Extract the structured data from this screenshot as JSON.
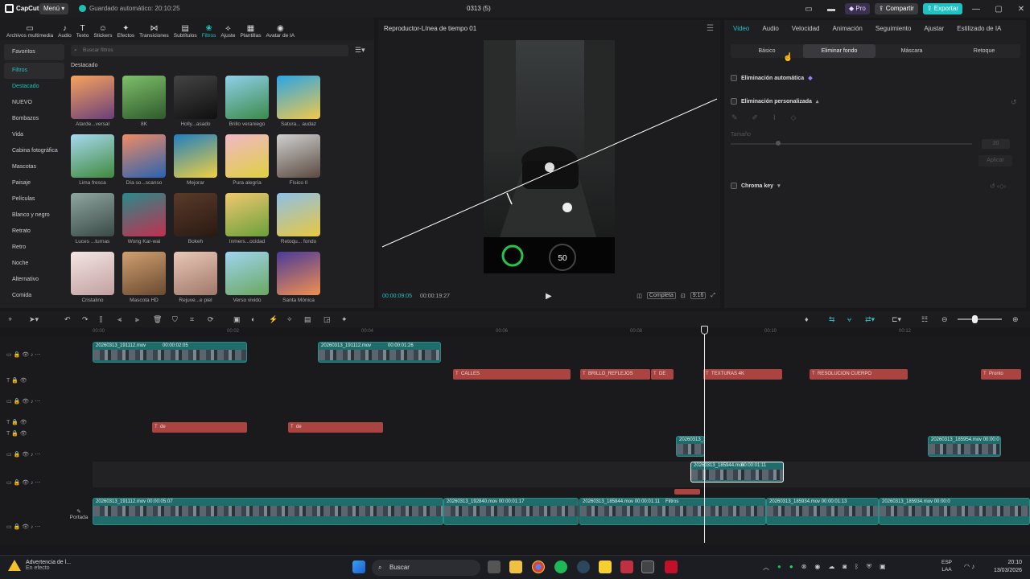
{
  "titlebar": {
    "app_name": "CapCut",
    "menu_label": "Menú",
    "autosave_text": "Guardado automático: 20:10:25",
    "project_title": "0313 (5)",
    "pro_label": "Pro",
    "share_label": "Compartir",
    "export_label": "Exportar"
  },
  "media_toolbar": [
    {
      "label": "Archivos multimedia",
      "icon": "▭"
    },
    {
      "label": "Audio",
      "icon": "♪"
    },
    {
      "label": "Texto",
      "icon": "T"
    },
    {
      "label": "Stickers",
      "icon": "☺"
    },
    {
      "label": "Efectos",
      "icon": "✦"
    },
    {
      "label": "Transiciones",
      "icon": "⋈"
    },
    {
      "label": "Subtítulos",
      "icon": "▤"
    },
    {
      "label": "Filtros",
      "icon": "❀"
    },
    {
      "label": "Ajuste",
      "icon": "⟡"
    },
    {
      "label": "Plantillas",
      "icon": "▦"
    },
    {
      "label": "Avatar de IA",
      "icon": "◉"
    }
  ],
  "filters_panel": {
    "search_placeholder": "Buscar filtros",
    "section_title": "Destacado",
    "categories": [
      "Favoritos",
      "Filtros",
      "Destacado",
      "NUEVO",
      "Bombazos",
      "Vida",
      "Cabina fotográfica",
      "Mascotas",
      "Paisaje",
      "Películas",
      "Blanco y negro",
      "Retrato",
      "Retro",
      "Noche",
      "Alternativo",
      "Comida"
    ],
    "tiles": [
      {
        "label": "Atarde...versal",
        "colors": [
          "#f7a35c",
          "#6a3f7a"
        ]
      },
      {
        "label": "8K",
        "colors": [
          "#7fbf6a",
          "#2f5a2c"
        ]
      },
      {
        "label": "Holly...asado",
        "colors": [
          "#444444",
          "#0f0f0f"
        ]
      },
      {
        "label": "Brillo veraniego",
        "colors": [
          "#8fd0ea",
          "#3c8a4a"
        ]
      },
      {
        "label": "Satura... audaz",
        "colors": [
          "#2aa5e6",
          "#f2c84a"
        ]
      },
      {
        "label": "Lima fresca",
        "colors": [
          "#a8d8f0",
          "#3f8a3c"
        ]
      },
      {
        "label": "Día so...scanso",
        "colors": [
          "#f08c64",
          "#2a62b0"
        ]
      },
      {
        "label": "Mejorar",
        "colors": [
          "#1f7fc0",
          "#f0d040"
        ]
      },
      {
        "label": "Pura alegría",
        "colors": [
          "#f0b8c8",
          "#e0d040"
        ]
      },
      {
        "label": "Físico II",
        "colors": [
          "#d0d0d0",
          "#5a4a40"
        ]
      },
      {
        "label": "Luces ...turnas",
        "colors": [
          "#8fa6a0",
          "#3a4a46"
        ]
      },
      {
        "label": "Wong Kar-wai",
        "colors": [
          "#2a8a8a",
          "#c03050"
        ]
      },
      {
        "label": "Bokeh",
        "colors": [
          "#5a3a2a",
          "#2a1a12"
        ]
      },
      {
        "label": "Inmers...ocidad",
        "colors": [
          "#f0c870",
          "#6aa03a"
        ]
      },
      {
        "label": "Retoqu... fondo",
        "colors": [
          "#8ec0e8",
          "#e8c840"
        ]
      },
      {
        "label": "Cristalino",
        "colors": [
          "#f4e6e4",
          "#c0a0a0"
        ]
      },
      {
        "label": "Mascota HD",
        "colors": [
          "#d0a070",
          "#6a4a30"
        ]
      },
      {
        "label": "Rejuve...e piel",
        "colors": [
          "#e8c8b8",
          "#a07868"
        ]
      },
      {
        "label": "Verso vivido",
        "colors": [
          "#9fd4f0",
          "#6aa860"
        ]
      },
      {
        "label": "Santa Mónica",
        "colors": [
          "#4a3a9a",
          "#f09050"
        ]
      }
    ]
  },
  "player": {
    "title": "Reproductor-Línea de tiempo 01",
    "current_time": "00:00:09:05",
    "total_time": "00:00:19:27",
    "quality_label": "Completa",
    "ratio_label": "9:16",
    "speed_readout": "50"
  },
  "inspector": {
    "tabs": [
      "Video",
      "Audio",
      "Velocidad",
      "Animación",
      "Seguimiento",
      "Ajustar",
      "Estilizado de IA"
    ],
    "subtabs": [
      "Básico",
      "Eliminar fondo",
      "Máscara",
      "Retoque"
    ],
    "auto_removal": "Eliminación automática",
    "custom_removal": "Eliminación personalizada",
    "size_label": "Tamaño",
    "size_value": "30",
    "apply_label": "Aplicar",
    "chroma_key": "Chroma key"
  },
  "timeline": {
    "ruler": [
      "00:00",
      "00:02",
      "00:04",
      "00:06",
      "00:08",
      "00:10",
      "00:12"
    ],
    "video_clips_top": [
      {
        "name": "20260313_191112.mov",
        "dur": "00:00:02:05"
      },
      {
        "name": "20260313_191112.mov",
        "dur": "00:00:01:26"
      }
    ],
    "text_clips": [
      "CALLES",
      "BRILLO_REFLEJOS",
      "DE",
      "TEXTURAS 4K",
      "RESOLUCION CUERPO",
      "Pronto"
    ],
    "text_clips_2": [
      "de",
      "de"
    ],
    "overlay_clips": [
      "20260313_1",
      "20260313_185954.mov  00:00:0"
    ],
    "selected_clip": {
      "name": "20260313_185944.mov",
      "dur": "00:00:01:11"
    },
    "main_track": [
      {
        "name": "20260313_191112.mov  00:00:05:07"
      },
      {
        "name": "20260313_192840.mov  00:00:01:17"
      },
      {
        "name": "20260313_185844.mov  00:00:01:11"
      },
      {
        "name": "20260313_185934.mov  00:00:01:13"
      },
      {
        "name": "20260313_185934.mov  00:00:0"
      }
    ],
    "filter_tag": "Filtros",
    "cover_label": "Portada"
  },
  "taskbar": {
    "warning_title": "Advertencia de l...",
    "warning_sub": "En efecto",
    "search_label": "Buscar",
    "lang_1": "ESP",
    "lang_2": "LAA",
    "time": "20:10",
    "date": "13/03/2026"
  }
}
